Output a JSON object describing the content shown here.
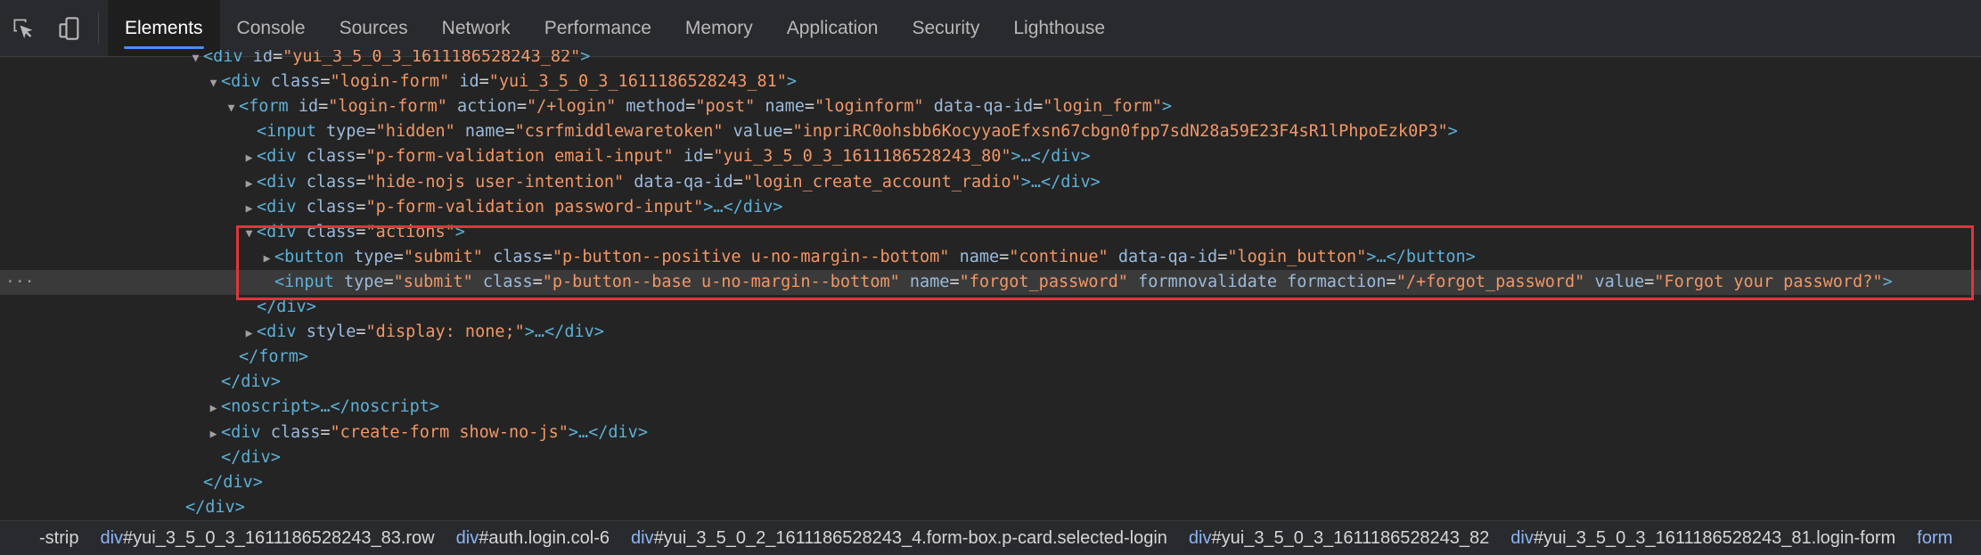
{
  "toolbar": {
    "inspect_icon": "inspect-element-icon",
    "device_icon": "device-toggle-icon",
    "tabs": [
      {
        "label": "Elements",
        "active": true
      },
      {
        "label": "Console"
      },
      {
        "label": "Sources"
      },
      {
        "label": "Network"
      },
      {
        "label": "Performance"
      },
      {
        "label": "Memory"
      },
      {
        "label": "Application"
      },
      {
        "label": "Security"
      },
      {
        "label": "Lighthouse"
      }
    ]
  },
  "tree": {
    "lines": [
      {
        "indent": 0,
        "arrow": "▼",
        "parts": [
          [
            "tag",
            "<div "
          ],
          [
            "an",
            "id"
          ],
          [
            "eq",
            "="
          ],
          [
            "av",
            "\"yui_3_5_0_3_1611186528243_82\""
          ],
          [
            "tag",
            ">"
          ]
        ]
      },
      {
        "indent": 1,
        "arrow": "▼",
        "parts": [
          [
            "tag",
            "<div "
          ],
          [
            "an",
            "class"
          ],
          [
            "eq",
            "="
          ],
          [
            "av",
            "\"login-form\""
          ],
          [
            "tag",
            " "
          ],
          [
            "an",
            "id"
          ],
          [
            "eq",
            "="
          ],
          [
            "av",
            "\"yui_3_5_0_3_1611186528243_81\""
          ],
          [
            "tag",
            ">"
          ]
        ]
      },
      {
        "indent": 2,
        "arrow": "▼",
        "parts": [
          [
            "tag",
            "<form "
          ],
          [
            "an",
            "id"
          ],
          [
            "eq",
            "="
          ],
          [
            "av",
            "\"login-form\""
          ],
          [
            "tag",
            " "
          ],
          [
            "an",
            "action"
          ],
          [
            "eq",
            "="
          ],
          [
            "av",
            "\"/+login\""
          ],
          [
            "tag",
            " "
          ],
          [
            "an",
            "method"
          ],
          [
            "eq",
            "="
          ],
          [
            "av",
            "\"post\""
          ],
          [
            "tag",
            " "
          ],
          [
            "an",
            "name"
          ],
          [
            "eq",
            "="
          ],
          [
            "av",
            "\"loginform\""
          ],
          [
            "tag",
            " "
          ],
          [
            "an",
            "data-qa-id"
          ],
          [
            "eq",
            "="
          ],
          [
            "av",
            "\"login_form\""
          ],
          [
            "tag",
            ">"
          ]
        ]
      },
      {
        "indent": 3,
        "arrow": "",
        "parts": [
          [
            "tag",
            "<input "
          ],
          [
            "an",
            "type"
          ],
          [
            "eq",
            "="
          ],
          [
            "av",
            "\"hidden\""
          ],
          [
            "tag",
            " "
          ],
          [
            "an",
            "name"
          ],
          [
            "eq",
            "="
          ],
          [
            "av",
            "\"csrfmiddlewaretoken\""
          ],
          [
            "tag",
            " "
          ],
          [
            "an",
            "value"
          ],
          [
            "eq",
            "="
          ],
          [
            "av",
            "\"inpriRC0ohsbb6KocyyaoEfxsn67cbgn0fpp7sdN28a59E23F4sR1lPhpoEzk0P3\""
          ],
          [
            "tag",
            ">"
          ]
        ]
      },
      {
        "indent": 3,
        "arrow": "▶",
        "parts": [
          [
            "tag",
            "<div "
          ],
          [
            "an",
            "class"
          ],
          [
            "eq",
            "="
          ],
          [
            "av",
            "\"p-form-validation email-input\""
          ],
          [
            "tag",
            " "
          ],
          [
            "an",
            "id"
          ],
          [
            "eq",
            "="
          ],
          [
            "av",
            "\"yui_3_5_0_3_1611186528243_80\""
          ],
          [
            "tag",
            ">…</div>"
          ]
        ]
      },
      {
        "indent": 3,
        "arrow": "▶",
        "parts": [
          [
            "tag",
            "<div "
          ],
          [
            "an",
            "class"
          ],
          [
            "eq",
            "="
          ],
          [
            "av",
            "\"hide-nojs user-intention\""
          ],
          [
            "tag",
            " "
          ],
          [
            "an",
            "data-qa-id"
          ],
          [
            "eq",
            "="
          ],
          [
            "av",
            "\"login_create_account_radio\""
          ],
          [
            "tag",
            ">…</div>"
          ]
        ]
      },
      {
        "indent": 3,
        "arrow": "▶",
        "parts": [
          [
            "tag",
            "<div "
          ],
          [
            "an",
            "class"
          ],
          [
            "eq",
            "="
          ],
          [
            "av",
            "\"p-form-validation password-input\""
          ],
          [
            "tag",
            ">…</div>"
          ]
        ]
      },
      {
        "indent": 3,
        "arrow": "▼",
        "parts": [
          [
            "tag",
            "<div "
          ],
          [
            "an",
            "class"
          ],
          [
            "eq",
            "="
          ],
          [
            "av",
            "\"actions\""
          ],
          [
            "tag",
            ">"
          ]
        ]
      },
      {
        "indent": 4,
        "arrow": "▶",
        "parts": [
          [
            "tag",
            "<button "
          ],
          [
            "an",
            "type"
          ],
          [
            "eq",
            "="
          ],
          [
            "av",
            "\"submit\""
          ],
          [
            "tag",
            " "
          ],
          [
            "an",
            "class"
          ],
          [
            "eq",
            "="
          ],
          [
            "av",
            "\"p-button--positive u-no-margin--bottom\""
          ],
          [
            "tag",
            " "
          ],
          [
            "an",
            "name"
          ],
          [
            "eq",
            "="
          ],
          [
            "av",
            "\"continue\""
          ],
          [
            "tag",
            " "
          ],
          [
            "an",
            "data-qa-id"
          ],
          [
            "eq",
            "="
          ],
          [
            "av",
            "\"login_button\""
          ],
          [
            "tag",
            ">…</button>"
          ]
        ]
      },
      {
        "indent": 4,
        "arrow": "",
        "selected": true,
        "parts": [
          [
            "tag",
            "<input "
          ],
          [
            "an",
            "type"
          ],
          [
            "eq",
            "="
          ],
          [
            "av",
            "\"submit\""
          ],
          [
            "tag",
            " "
          ],
          [
            "an",
            "class"
          ],
          [
            "eq",
            "="
          ],
          [
            "av",
            "\"p-button--base u-no-margin--bottom\""
          ],
          [
            "tag",
            " "
          ],
          [
            "an",
            "name"
          ],
          [
            "eq",
            "="
          ],
          [
            "av",
            "\"forgot_password\""
          ],
          [
            "tag",
            " "
          ],
          [
            "an",
            "formnovalidate"
          ],
          [
            "tag",
            " "
          ],
          [
            "an",
            "formaction"
          ],
          [
            "eq",
            "="
          ],
          [
            "av",
            "\"/+forgot_password\""
          ],
          [
            "tag",
            " "
          ],
          [
            "an",
            "value"
          ],
          [
            "eq",
            "="
          ],
          [
            "av",
            "\"Forgot your password?\""
          ],
          [
            "tag",
            ">"
          ]
        ]
      },
      {
        "indent": 3,
        "arrow": "",
        "parts": [
          [
            "tag",
            "</div>"
          ]
        ]
      },
      {
        "indent": 3,
        "arrow": "▶",
        "parts": [
          [
            "tag",
            "<div "
          ],
          [
            "an",
            "style"
          ],
          [
            "eq",
            "="
          ],
          [
            "av",
            "\"display: none;\""
          ],
          [
            "tag",
            ">…</div>"
          ]
        ]
      },
      {
        "indent": 2,
        "arrow": "",
        "parts": [
          [
            "tag",
            "</form>"
          ]
        ]
      },
      {
        "indent": 1,
        "arrow": "",
        "parts": [
          [
            "tag",
            "</div>"
          ]
        ]
      },
      {
        "indent": 1,
        "arrow": "▶",
        "parts": [
          [
            "tag",
            "<noscript>…</noscript>"
          ]
        ]
      },
      {
        "indent": 1,
        "arrow": "▶",
        "parts": [
          [
            "tag",
            "<div "
          ],
          [
            "an",
            "class"
          ],
          [
            "eq",
            "="
          ],
          [
            "av",
            "\"create-form show-no-js\""
          ],
          [
            "tag",
            ">…</div>"
          ]
        ]
      },
      {
        "indent": 1,
        "arrow": "",
        "parts": [
          [
            "tag",
            "</div>"
          ]
        ]
      },
      {
        "indent": 0,
        "arrow": "",
        "parts": [
          [
            "tag",
            "</div>"
          ]
        ]
      },
      {
        "indent": -1,
        "arrow": "",
        "parts": [
          [
            "tag",
            "</div>"
          ]
        ]
      }
    ],
    "selected_dots": "···"
  },
  "breadcrumbs": [
    {
      "el": "",
      "rest": "-strip"
    },
    {
      "el": "div",
      "rest": "#yui_3_5_0_3_1611186528243_83.row"
    },
    {
      "el": "div",
      "rest": "#auth.login.col-6"
    },
    {
      "el": "div",
      "rest": "#yui_3_5_0_2_1611186528243_4.form-box.p-card.selected-login"
    },
    {
      "el": "div",
      "rest": "#yui_3_5_0_3_1611186528243_82"
    },
    {
      "el": "div",
      "rest": "#yui_3_5_0_3_1611186528243_81.login-form"
    },
    {
      "el": "form",
      "rest": ""
    }
  ]
}
